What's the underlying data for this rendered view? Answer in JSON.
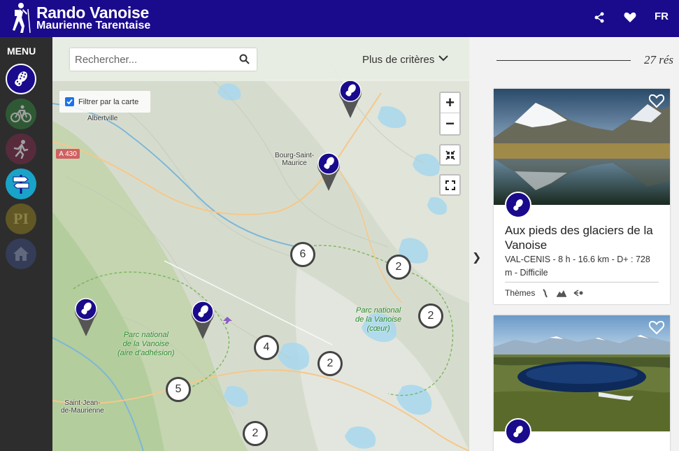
{
  "header": {
    "brand_line1": "Rando Vanoise",
    "brand_line2": "Maurienne Tarentaise",
    "lang": "FR",
    "bg_color": "#1a0a8c"
  },
  "sidebar": {
    "menu_label": "MENU",
    "items": [
      {
        "name": "hiking",
        "icon": "boot-icon",
        "color": "#1a0a8c",
        "active": true
      },
      {
        "name": "cycling",
        "icon": "bike-icon",
        "color": "#2f7d3a"
      },
      {
        "name": "trail-running",
        "icon": "runner-icon",
        "color": "#7a2a4a"
      },
      {
        "name": "signposts",
        "icon": "signpost-icon",
        "color": "#1aa3c8"
      },
      {
        "name": "points-of-interest",
        "icon": "pi-icon",
        "label": "PI",
        "color": "#8a7a20"
      },
      {
        "name": "refuges",
        "icon": "house-icon",
        "color": "#3a4a7a"
      }
    ]
  },
  "search": {
    "placeholder": "Rechercher...",
    "criteria_label": "Plus de critères"
  },
  "map": {
    "filter_label": "Filtrer par la carte",
    "zoom_in": "+",
    "zoom_out": "−",
    "places": [
      "Albertville",
      "Bourg-Saint-Maurice",
      "Saint-Jean-de-Maurienne"
    ],
    "place_bourg_1": "Bourg-Saint-",
    "place_bourg_2": "Maurice",
    "place_stjean_1": "Saint-Jean-",
    "place_stjean_2": "de-Maurienne",
    "road": "A 430",
    "park_core_1": "Parc national",
    "park_core_2": "de la Vanoise",
    "park_core_3": "(cœur)",
    "park_adh_1": "Parc national",
    "park_adh_2": "de la Vanoise",
    "park_adh_3": "(aire d'adhésion)",
    "clusters": [
      "6",
      "2",
      "2",
      "4",
      "2",
      "5",
      "2"
    ]
  },
  "results": {
    "count_label": "27 rés"
  },
  "cards": [
    {
      "title": "Aux pieds des glaciers de la Vanoise",
      "meta": "VAL-CENIS  -  8 h  -  16.6 km  -  D+ : 728 m  -  Difficile",
      "themes_label": "Thèmes"
    },
    {
      "title": ""
    }
  ]
}
